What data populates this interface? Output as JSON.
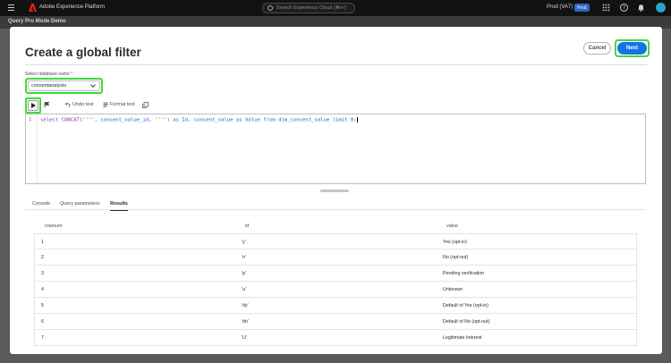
{
  "topbar": {
    "app_title": "Adobe Experience Platform",
    "search_placeholder": "Search Experience Cloud (⌘+/)",
    "org": "Prod (VA7)",
    "env_badge": "Prod"
  },
  "subbar": {
    "title": "Query Pro Mode Demo"
  },
  "modal": {
    "title": "Create a global filter",
    "cancel_label": "Cancel",
    "next_label": "Next",
    "db_label": "Select database name",
    "db_required_mark": "*",
    "db_value": "consentanalysis",
    "toolbar": {
      "undo_label": "Undo text",
      "format_label": "Format text"
    },
    "editor": {
      "line_number": "1",
      "query_parts": {
        "p1": "select CONCAT(",
        "s1": "''''",
        "p2": ", consent_value_id, ",
        "s2": "''''",
        "p3": ") as Id, consent_value as Value from dim_consent_value limit 0;"
      }
    },
    "tabs": [
      {
        "label": "Console"
      },
      {
        "label": "Query parameters"
      },
      {
        "label": "Results"
      }
    ],
    "active_tab": "Results",
    "table": {
      "headers": [
        "rownum",
        "id",
        "value"
      ],
      "rows": [
        {
          "rownum": "1",
          "id": "'y'",
          "value": "Yes (opt-in)"
        },
        {
          "rownum": "2",
          "id": "'n'",
          "value": "No (opt-out)"
        },
        {
          "rownum": "3",
          "id": "'p'",
          "value": "Pending verification"
        },
        {
          "rownum": "4",
          "id": "'u'",
          "value": "Unknown"
        },
        {
          "rownum": "5",
          "id": "'dy'",
          "value": "Default of Yes (opt-in)"
        },
        {
          "rownum": "6",
          "id": "'dn'",
          "value": "Default of No (opt-out)"
        },
        {
          "rownum": "7",
          "id": "'LI'",
          "value": "Legitimate Interest"
        }
      ]
    }
  },
  "colors": {
    "highlight": "#3ddc3d",
    "primary": "#1473e6"
  }
}
